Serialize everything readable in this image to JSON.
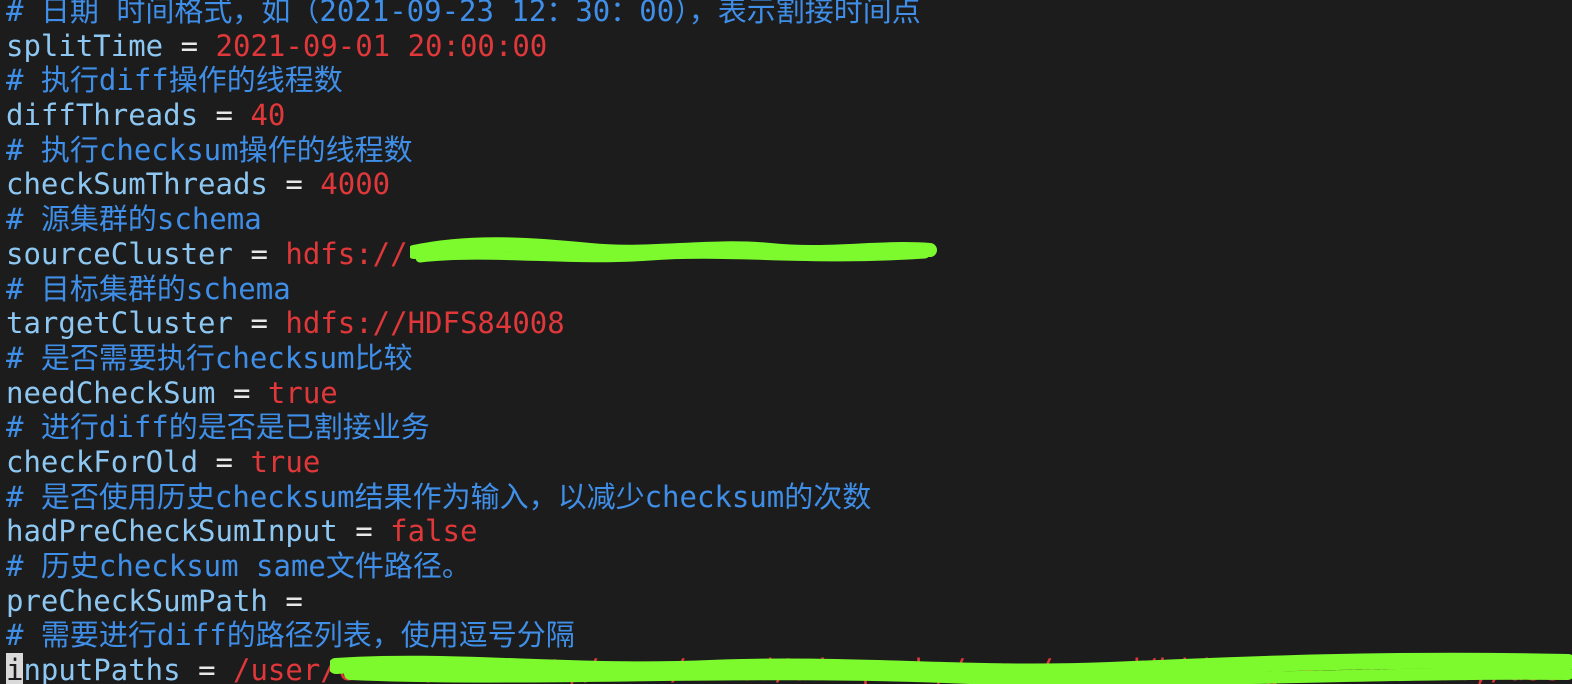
{
  "editor": {
    "lines": [
      {
        "type": "comment",
        "text": "# 日期 时间格式，如（2021-09-23 12：30：00），表示割接时间点"
      },
      {
        "type": "kv",
        "key": "splitTime",
        "op": " = ",
        "value": "2021-09-01 20:00:00"
      },
      {
        "type": "comment",
        "text": "# 执行diff操作的线程数"
      },
      {
        "type": "kv",
        "key": "diffThreads",
        "op": " = ",
        "value": "40"
      },
      {
        "type": "comment",
        "text": "# 执行checksum操作的线程数"
      },
      {
        "type": "kv",
        "key": "checkSumThreads",
        "op": " = ",
        "value": "4000"
      },
      {
        "type": "comment",
        "text": "# 源集群的schema"
      },
      {
        "type": "kv",
        "key": "sourceCluster",
        "op": " = ",
        "value": "hdfs://"
      },
      {
        "type": "comment",
        "text": "# 目标集群的schema"
      },
      {
        "type": "kv",
        "key": "targetCluster",
        "op": " = ",
        "value": "hdfs://HDFS84008"
      },
      {
        "type": "comment",
        "text": "# 是否需要执行checksum比较"
      },
      {
        "type": "kv",
        "key": "needCheckSum",
        "op": " = ",
        "value": "true"
      },
      {
        "type": "comment",
        "text": "# 进行diff的是否是已割接业务"
      },
      {
        "type": "kv",
        "key": "checkForOld",
        "op": " = ",
        "value": "true"
      },
      {
        "type": "comment",
        "text": "# 是否使用历史checksum结果作为输入，以减少checksum的次数"
      },
      {
        "type": "kv",
        "key": "hadPreCheckSumInput",
        "op": " = ",
        "value": "false"
      },
      {
        "type": "comment",
        "text": "# 历史checksum same文件路径。"
      },
      {
        "type": "kv",
        "key": "preCheckSumPath",
        "op": " =",
        "value": ""
      },
      {
        "type": "comment",
        "text": "# 需要进行diff的路径列表，使用逗号分隔"
      },
      {
        "type": "kv",
        "key": "inputPaths",
        "op": " = ",
        "value": "/user/ca_ad/Current,/user/ca_ad/ad-spark,/user/ca_ad/bidding_account_db,/user",
        "cursor_first_char": true
      }
    ]
  },
  "colors": {
    "background": "#1c1c1c",
    "comment": "#3f8ee8",
    "key": "#8ec8f2",
    "operator": "#e8e8e8",
    "value": "#e0383a",
    "redaction": "#7dfa2e"
  }
}
